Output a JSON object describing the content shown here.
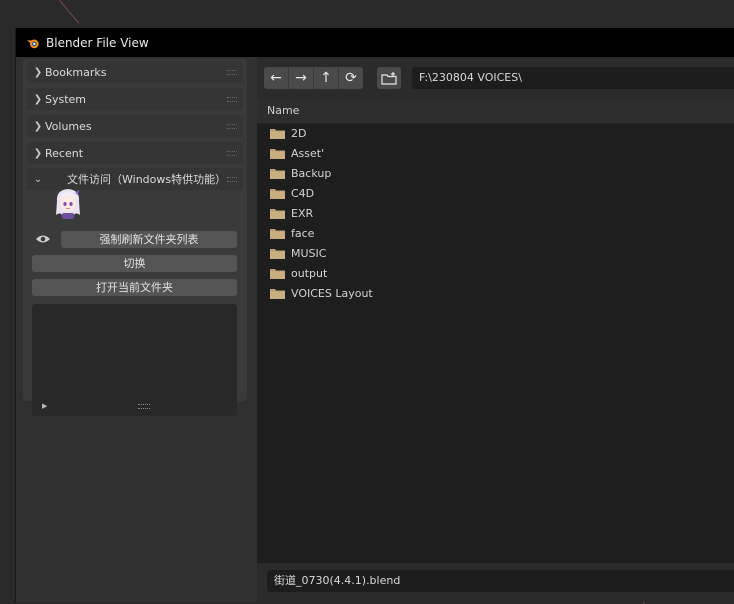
{
  "window": {
    "title": "Blender File View"
  },
  "sidebar": {
    "panels": [
      {
        "label": "Bookmarks"
      },
      {
        "label": "System"
      },
      {
        "label": "Volumes"
      },
      {
        "label": "Recent"
      }
    ],
    "addon": {
      "header_label": "文件访问（Windows特供功能）",
      "refresh_button": "强制刷新文件夹列表",
      "toggle_button": "切换",
      "open_folder_button": "打开当前文件夹"
    }
  },
  "toolbar": {
    "back_icon": "←",
    "forward_icon": "→",
    "parent_icon": "↑",
    "refresh_icon": "⟳",
    "path": "F:\\230804 VOICES\\"
  },
  "file_list": {
    "column_name": "Name",
    "items": [
      {
        "name": "2D"
      },
      {
        "name": "Asset'"
      },
      {
        "name": "Backup"
      },
      {
        "name": "C4D"
      },
      {
        "name": "EXR"
      },
      {
        "name": "face"
      },
      {
        "name": "MUSIC"
      },
      {
        "name": "output"
      },
      {
        "name": "VOICES Layout"
      }
    ]
  },
  "footer": {
    "filename": "街道_0730(4.4.1).blend"
  },
  "colors": {
    "folder": "#b9a077",
    "title_bar": "#000000",
    "panel": "#3a3a3a",
    "file_area": "#1e1e1e"
  }
}
